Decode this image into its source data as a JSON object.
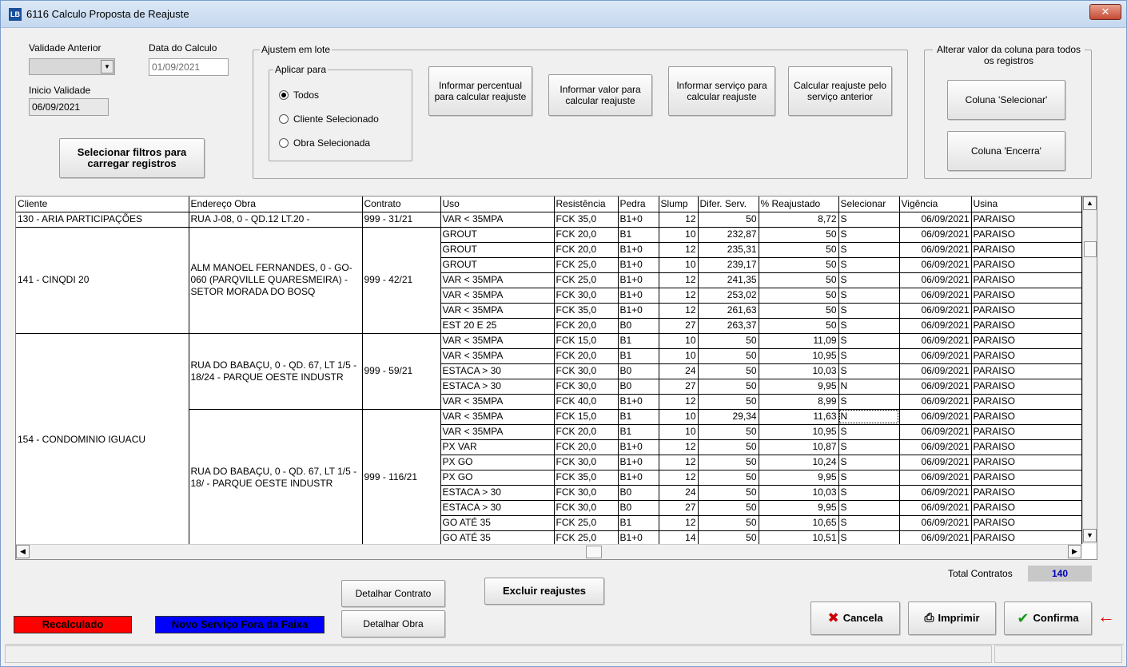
{
  "window": {
    "title": "6116 Calculo Proposta de Reajuste",
    "app_icon": "LB",
    "close": "✕"
  },
  "form": {
    "validade_anterior_label": "Validade Anterior",
    "data_calculo_label": "Data do Calculo",
    "data_calculo_value": "01/09/2021",
    "inicio_validade_label": "Inicio Validade",
    "inicio_validade_value": "06/09/2021",
    "selecionar_filtros": "Selecionar filtros para carregar registros"
  },
  "lote": {
    "title": "Ajustem em lote",
    "aplicar_title": "Aplicar para",
    "radios": [
      "Todos",
      "Cliente Selecionado",
      "Obra Selecionada"
    ],
    "selected_radio": "Todos",
    "buttons": [
      "Informar percentual para calcular reajuste",
      "Informar valor para calcular reajuste",
      "Informar serviço para calcular reajuste",
      "Calcular reajuste pelo serviço anterior"
    ]
  },
  "alterar": {
    "title": "Alterar valor da coluna para todos os registros",
    "buttons": [
      "Coluna 'Selecionar'",
      "Coluna 'Encerra'"
    ]
  },
  "grid": {
    "columns": [
      "Cliente",
      "Endereço Obra",
      "Contrato",
      "Uso",
      "Resistência",
      "Pedra",
      "Slump",
      "Difer. Serv.",
      "% Reajustado",
      "Selecionar",
      "Vigência",
      "Usina"
    ],
    "groups": [
      {
        "cliente": "130 - ARIA PARTICIPAÇÕES",
        "obras": [
          {
            "endereco": "RUA J-08, 0 - QD.12 LT.20 -",
            "contrato": "999 - 31/21",
            "rows": [
              [
                "VAR < 35MPA",
                "FCK 35,0",
                "B1+0",
                "12",
                "50",
                "8,72",
                "S",
                "06/09/2021",
                "PARAISO"
              ]
            ]
          }
        ]
      },
      {
        "cliente": "141 - CINQDI 20",
        "obras": [
          {
            "endereco": "ALM MANOEL FERNANDES, 0 - GO-060 (PARQVILLE QUARESMEIRA) - SETOR MORADA DO BOSQ",
            "contrato": "999 - 42/21",
            "rows": [
              [
                "GROUT",
                "FCK 20,0",
                "B1",
                "10",
                "232,87",
                "50",
                "S",
                "06/09/2021",
                "PARAISO"
              ],
              [
                "GROUT",
                "FCK 20,0",
                "B1+0",
                "12",
                "235,31",
                "50",
                "S",
                "06/09/2021",
                "PARAISO"
              ],
              [
                "GROUT",
                "FCK 25,0",
                "B1+0",
                "10",
                "239,17",
                "50",
                "S",
                "06/09/2021",
                "PARAISO"
              ],
              [
                "VAR < 35MPA",
                "FCK 25,0",
                "B1+0",
                "12",
                "241,35",
                "50",
                "S",
                "06/09/2021",
                "PARAISO"
              ],
              [
                "VAR < 35MPA",
                "FCK 30,0",
                "B1+0",
                "12",
                "253,02",
                "50",
                "S",
                "06/09/2021",
                "PARAISO"
              ],
              [
                "VAR < 35MPA",
                "FCK 35,0",
                "B1+0",
                "12",
                "261,63",
                "50",
                "S",
                "06/09/2021",
                "PARAISO"
              ],
              [
                "EST 20 E 25",
                "FCK 20,0",
                "B0",
                "27",
                "263,37",
                "50",
                "S",
                "06/09/2021",
                "PARAISO"
              ]
            ]
          }
        ]
      },
      {
        "cliente": "154 - CONDOMINIO IGUACU",
        "obras": [
          {
            "endereco": "RUA DO BABAÇU, 0 - QD. 67, LT 1/5 - 18/24 - PARQUE OESTE INDUSTR",
            "contrato": "999 - 59/21",
            "rows": [
              [
                "VAR < 35MPA",
                "FCK 15,0",
                "B1",
                "10",
                "50",
                "11,09",
                "S",
                "06/09/2021",
                "PARAISO"
              ],
              [
                "VAR < 35MPA",
                "FCK 20,0",
                "B1",
                "10",
                "50",
                "10,95",
                "S",
                "06/09/2021",
                "PARAISO"
              ],
              [
                "ESTACA > 30",
                "FCK 30,0",
                "B0",
                "24",
                "50",
                "10,03",
                "S",
                "06/09/2021",
                "PARAISO"
              ],
              [
                "ESTACA > 30",
                "FCK 30,0",
                "B0",
                "27",
                "50",
                "9,95",
                "N",
                "06/09/2021",
                "PARAISO"
              ],
              [
                "VAR < 35MPA",
                "FCK 40,0",
                "B1+0",
                "12",
                "50",
                "8,99",
                "S",
                "06/09/2021",
                "PARAISO"
              ]
            ]
          },
          {
            "endereco": "RUA DO BABAÇU, 0 - QD. 67, LT 1/5 - 18/ - PARQUE OESTE INDUSTR",
            "contrato": "999 - 116/21",
            "rows": [
              [
                "VAR < 35MPA",
                "FCK 15,0",
                "B1",
                "10",
                "29,34",
                "11,63",
                "N",
                "06/09/2021",
                "PARAISO"
              ],
              [
                "VAR < 35MPA",
                "FCK 20,0",
                "B1",
                "10",
                "50",
                "10,95",
                "S",
                "06/09/2021",
                "PARAISO"
              ],
              [
                "PX VAR",
                "FCK 20,0",
                "B1+0",
                "12",
                "50",
                "10,87",
                "S",
                "06/09/2021",
                "PARAISO"
              ],
              [
                "PX GO",
                "FCK 30,0",
                "B1+0",
                "12",
                "50",
                "10,24",
                "S",
                "06/09/2021",
                "PARAISO"
              ],
              [
                "PX GO",
                "FCK 35,0",
                "B1+0",
                "12",
                "50",
                "9,95",
                "S",
                "06/09/2021",
                "PARAISO"
              ],
              [
                "ESTACA > 30",
                "FCK 30,0",
                "B0",
                "24",
                "50",
                "10,03",
                "S",
                "06/09/2021",
                "PARAISO"
              ],
              [
                "ESTACA > 30",
                "FCK 30,0",
                "B0",
                "27",
                "50",
                "9,95",
                "S",
                "06/09/2021",
                "PARAISO"
              ],
              [
                "GO ATÉ 35",
                "FCK 25,0",
                "B1",
                "12",
                "50",
                "10,65",
                "S",
                "06/09/2021",
                "PARAISO"
              ],
              [
                "GO ATÉ 35",
                "FCK 25,0",
                "B1+0",
                "14",
                "50",
                "10,51",
                "S",
                "06/09/2021",
                "PARAISO"
              ]
            ]
          }
        ]
      }
    ]
  },
  "footer": {
    "total_label": "Total Contratos",
    "total_value": "140",
    "detalhar_contrato": "Detalhar Contrato",
    "detalhar_obra": "Detalhar Obra",
    "excluir": "Excluir reajustes",
    "legend_recalculado": "Recalculado",
    "legend_novo": "Novo Serviço Fora da Faixa",
    "cancela": "Cancela",
    "imprimir": "Imprimir",
    "confirma": "Confirma",
    "arrow": "←"
  },
  "colors": {
    "recalculado": "#ff0000",
    "novo_servico": "#0000ff",
    "total_value": "#0000c0",
    "arrow": "#e00000",
    "cancel_icon": "#cc0000",
    "confirm_icon": "#1a9a1a"
  }
}
